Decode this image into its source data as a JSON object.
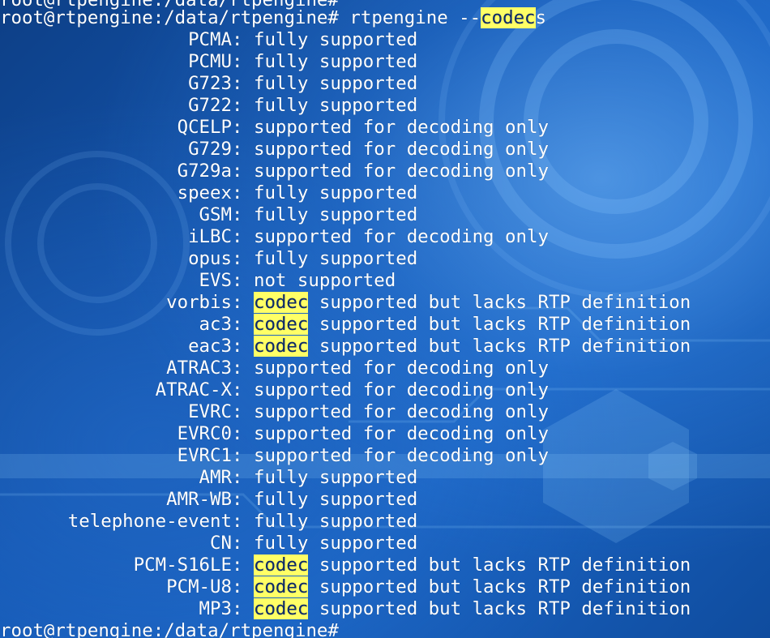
{
  "terminal": {
    "top_partial_line": "root@rtpengine:/data/rtpengine#",
    "command_prompt": "root@rtpengine:/data/rtpengine# ",
    "command_text": "rtpengine --",
    "command_highlight": "codec",
    "command_tail": "s",
    "end_prompt": "root@rtpengine:/data/rtpengine#",
    "highlight_color": "#ffff66",
    "codecs": [
      {
        "name": "PCMA",
        "status": "fully supported"
      },
      {
        "name": "PCMU",
        "status": "fully supported"
      },
      {
        "name": "G723",
        "status": "fully supported"
      },
      {
        "name": "G722",
        "status": "fully supported"
      },
      {
        "name": "QCELP",
        "status": "supported for decoding only"
      },
      {
        "name": "G729",
        "status": "supported for decoding only"
      },
      {
        "name": "G729a",
        "status": "supported for decoding only"
      },
      {
        "name": "speex",
        "status": "fully supported"
      },
      {
        "name": "GSM",
        "status": "fully supported"
      },
      {
        "name": "iLBC",
        "status": "supported for decoding only"
      },
      {
        "name": "opus",
        "status": "fully supported"
      },
      {
        "name": "EVS",
        "status": "not supported"
      },
      {
        "name": "vorbis",
        "status_highlight": "codec",
        "status": " supported but lacks RTP definition"
      },
      {
        "name": "ac3",
        "status_highlight": "codec",
        "status": " supported but lacks RTP definition"
      },
      {
        "name": "eac3",
        "status_highlight": "codec",
        "status": " supported but lacks RTP definition"
      },
      {
        "name": "ATRAC3",
        "status": "supported for decoding only"
      },
      {
        "name": "ATRAC-X",
        "status": "supported for decoding only"
      },
      {
        "name": "EVRC",
        "status": "supported for decoding only"
      },
      {
        "name": "EVRC0",
        "status": "supported for decoding only"
      },
      {
        "name": "EVRC1",
        "status": "supported for decoding only"
      },
      {
        "name": "AMR",
        "status": "fully supported"
      },
      {
        "name": "AMR-WB",
        "status": "fully supported"
      },
      {
        "name": "telephone-event",
        "status": "fully supported"
      },
      {
        "name": "CN",
        "status": "fully supported"
      },
      {
        "name": "PCM-S16LE",
        "status_highlight": "codec",
        "status": " supported but lacks RTP definition"
      },
      {
        "name": "PCM-U8",
        "status_highlight": "codec",
        "status": " supported but lacks RTP definition"
      },
      {
        "name": "MP3",
        "status_highlight": "codec",
        "status": " supported but lacks RTP definition"
      }
    ]
  }
}
